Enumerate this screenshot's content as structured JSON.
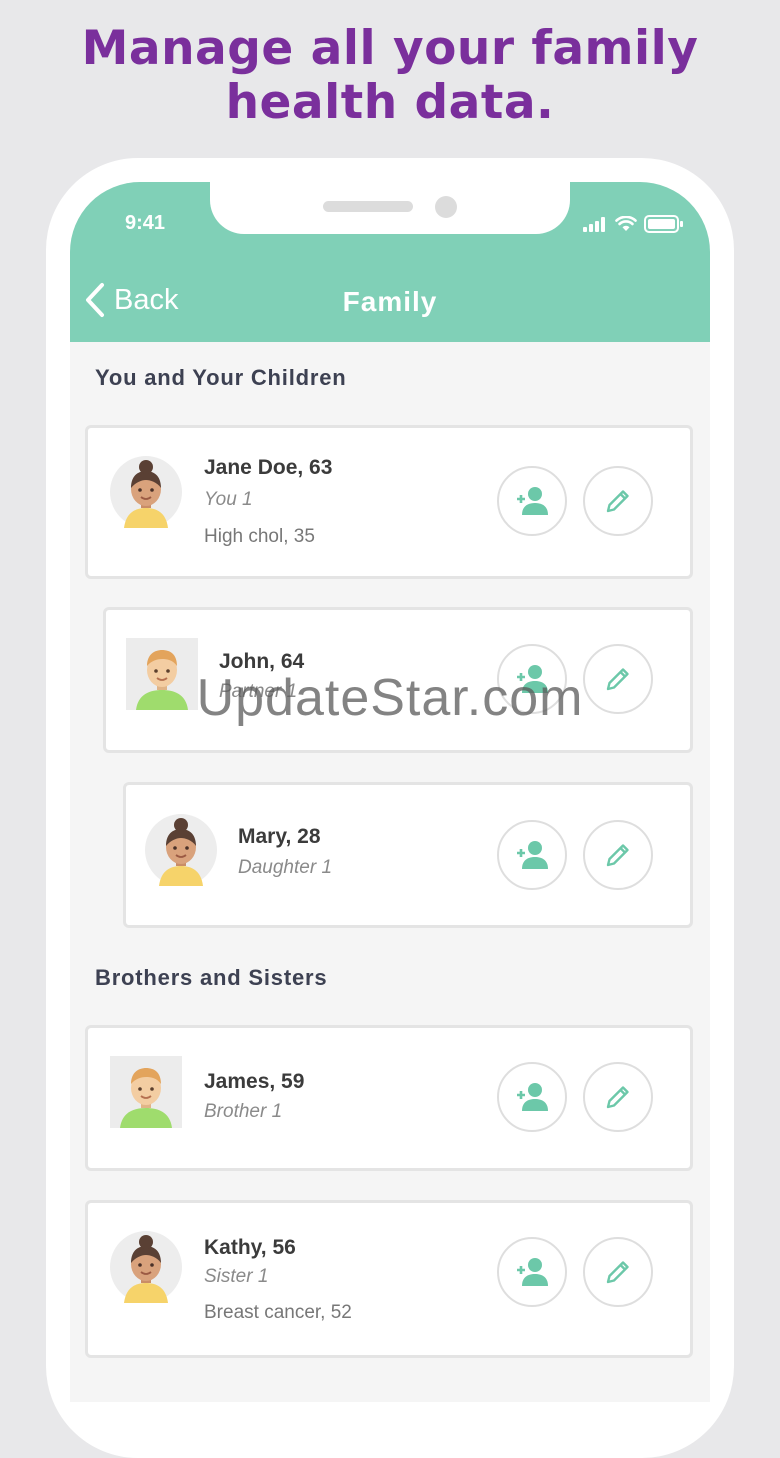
{
  "headline": {
    "line1": "Manage all your family",
    "line2": "health data."
  },
  "status": {
    "time": "9:41"
  },
  "nav": {
    "back_label": "Back",
    "title": "Family"
  },
  "sections": {
    "children": "You and Your Children",
    "siblings": "Brothers and Sisters"
  },
  "members": [
    {
      "name": "Jane Doe, 63",
      "relation": "You 1",
      "condition": "High chol, 35",
      "avatar": "female-avatar"
    },
    {
      "name": "John, 64",
      "relation": "Partner 1",
      "condition": "",
      "avatar": "male-avatar"
    },
    {
      "name": "Mary, 28",
      "relation": "Daughter 1",
      "condition": "",
      "avatar": "female-avatar"
    },
    {
      "name": "James, 59",
      "relation": "Brother 1",
      "condition": "",
      "avatar": "male-avatar"
    },
    {
      "name": "Kathy, 56",
      "relation": "Sister 1",
      "condition": "Breast cancer, 52",
      "avatar": "female-avatar"
    }
  ],
  "watermark": "UpdateStar.com",
  "colors": {
    "accent": "#80d0b7",
    "headline": "#7a2f9c",
    "icon": "#6cc8a9"
  }
}
